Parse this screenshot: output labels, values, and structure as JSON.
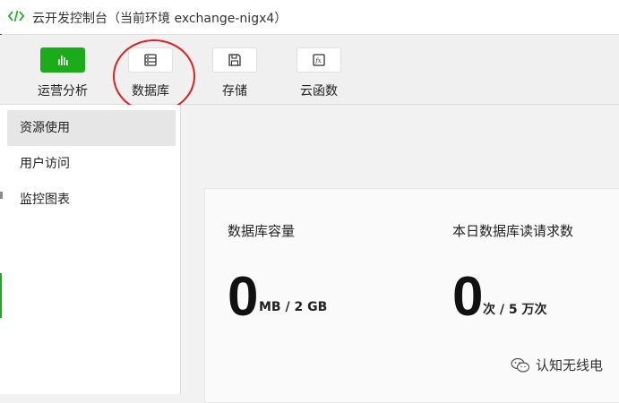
{
  "window": {
    "title": "云开发控制台（当前环境 exchange-nigx4）"
  },
  "toolbar": {
    "items": [
      {
        "label": "运营分析",
        "icon": "bar-chart-icon",
        "active": true
      },
      {
        "label": "数据库",
        "icon": "database-icon",
        "active": false
      },
      {
        "label": "存储",
        "icon": "save-icon",
        "active": false
      },
      {
        "label": "云函数",
        "icon": "function-icon",
        "active": false
      }
    ]
  },
  "sidebar": {
    "items": [
      {
        "label": "资源使用",
        "active": true
      },
      {
        "label": "用户访问",
        "active": false
      },
      {
        "label": "监控图表",
        "active": false
      }
    ]
  },
  "main": {
    "metrics": [
      {
        "title": "数据库容量",
        "value": "0",
        "unit": "MB / 2 GB"
      },
      {
        "title": "本日数据库读请求数",
        "value": "0",
        "unit": "次 / 5 万次"
      }
    ]
  },
  "watermark": {
    "text": "认知无线电",
    "icon": "wechat-icon"
  },
  "colors": {
    "accent": "#1aad19",
    "highlight_circle": "#e02020"
  }
}
